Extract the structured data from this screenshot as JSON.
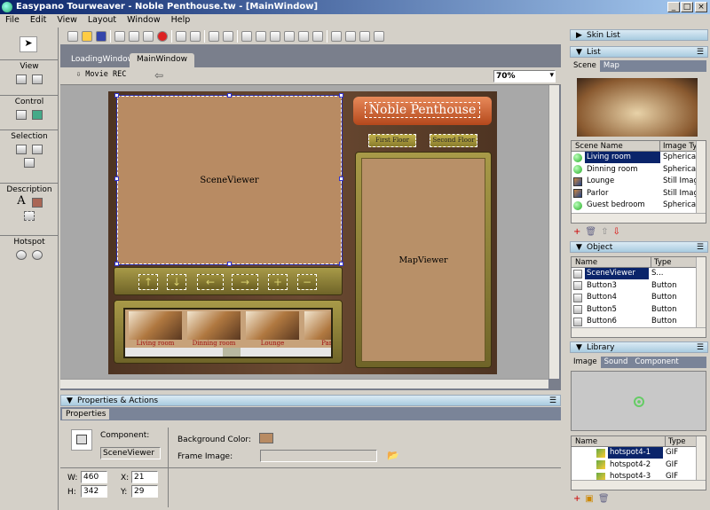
{
  "window": {
    "title": "Easypano Tourweaver - Noble Penthouse.tw - [MainWindow]",
    "min": "_",
    "max": "□",
    "close": "×"
  },
  "menu": [
    "File",
    "Edit",
    "View",
    "Layout",
    "Window",
    "Help"
  ],
  "toolbox": {
    "groups": [
      "View",
      "Control",
      "Selection",
      "Description",
      "Hotspot"
    ]
  },
  "tabs": [
    "LoadingWindow",
    "MainWindow"
  ],
  "docbar": {
    "movie_rec": "Movie REC",
    "zoom": "70%"
  },
  "skin": {
    "title": "Noble Penthouse",
    "floors": [
      "First Floor",
      "Second Floor"
    ],
    "scene_viewer": "SceneViewer",
    "map_viewer": "MapViewer",
    "nav_buttons": [
      "↑",
      "↓",
      "←",
      "→",
      "+",
      "−"
    ],
    "thumbnails": [
      "Living room",
      "Dinning room",
      "Lounge",
      "Parlor"
    ]
  },
  "properties": {
    "panel_title": "Properties & Actions",
    "tab": "Properties",
    "component_label": "Component:",
    "component_value": "SceneViewer",
    "bg_color_label": "Background Color:",
    "bg_color": "#b88b63",
    "frame_image_label": "Frame Image:",
    "frame_image_value": "",
    "w_label": "W:",
    "w": "460",
    "h_label": "H:",
    "h": "342",
    "x_label": "X:",
    "x": "21",
    "y_label": "Y:",
    "y": "29"
  },
  "right": {
    "skin_list": "Skin List",
    "list": "List",
    "list_tabs": [
      "Scene",
      "Map"
    ],
    "scene_cols": [
      "Scene Name",
      "Image Ty"
    ],
    "scenes": [
      {
        "name": "Living room",
        "type": "Spherical",
        "icon": "sphere"
      },
      {
        "name": "Dinning room",
        "type": "Spherical",
        "icon": "sphere"
      },
      {
        "name": "Lounge",
        "type": "Still Image",
        "icon": "still"
      },
      {
        "name": "Parlor",
        "type": "Still Image",
        "icon": "still"
      },
      {
        "name": "Guest bedroom",
        "type": "Spherical",
        "icon": "sphere"
      }
    ],
    "object": "Object",
    "object_cols": [
      "Name",
      "Type"
    ],
    "objects": [
      {
        "name": "SceneViewer",
        "type": "S..."
      },
      {
        "name": "Button3",
        "type": "Button"
      },
      {
        "name": "Button4",
        "type": "Button"
      },
      {
        "name": "Button5",
        "type": "Button"
      },
      {
        "name": "Button6",
        "type": "Button"
      }
    ],
    "library": "Library",
    "library_tabs": [
      "Image",
      "Sound",
      "Component"
    ],
    "library_cols": [
      "Name",
      "Type"
    ],
    "library_items": [
      {
        "name": "hotspot4-1",
        "type": "GIF"
      },
      {
        "name": "hotspot4-2",
        "type": "GIF"
      },
      {
        "name": "hotspot4-3",
        "type": "GIF"
      }
    ]
  }
}
